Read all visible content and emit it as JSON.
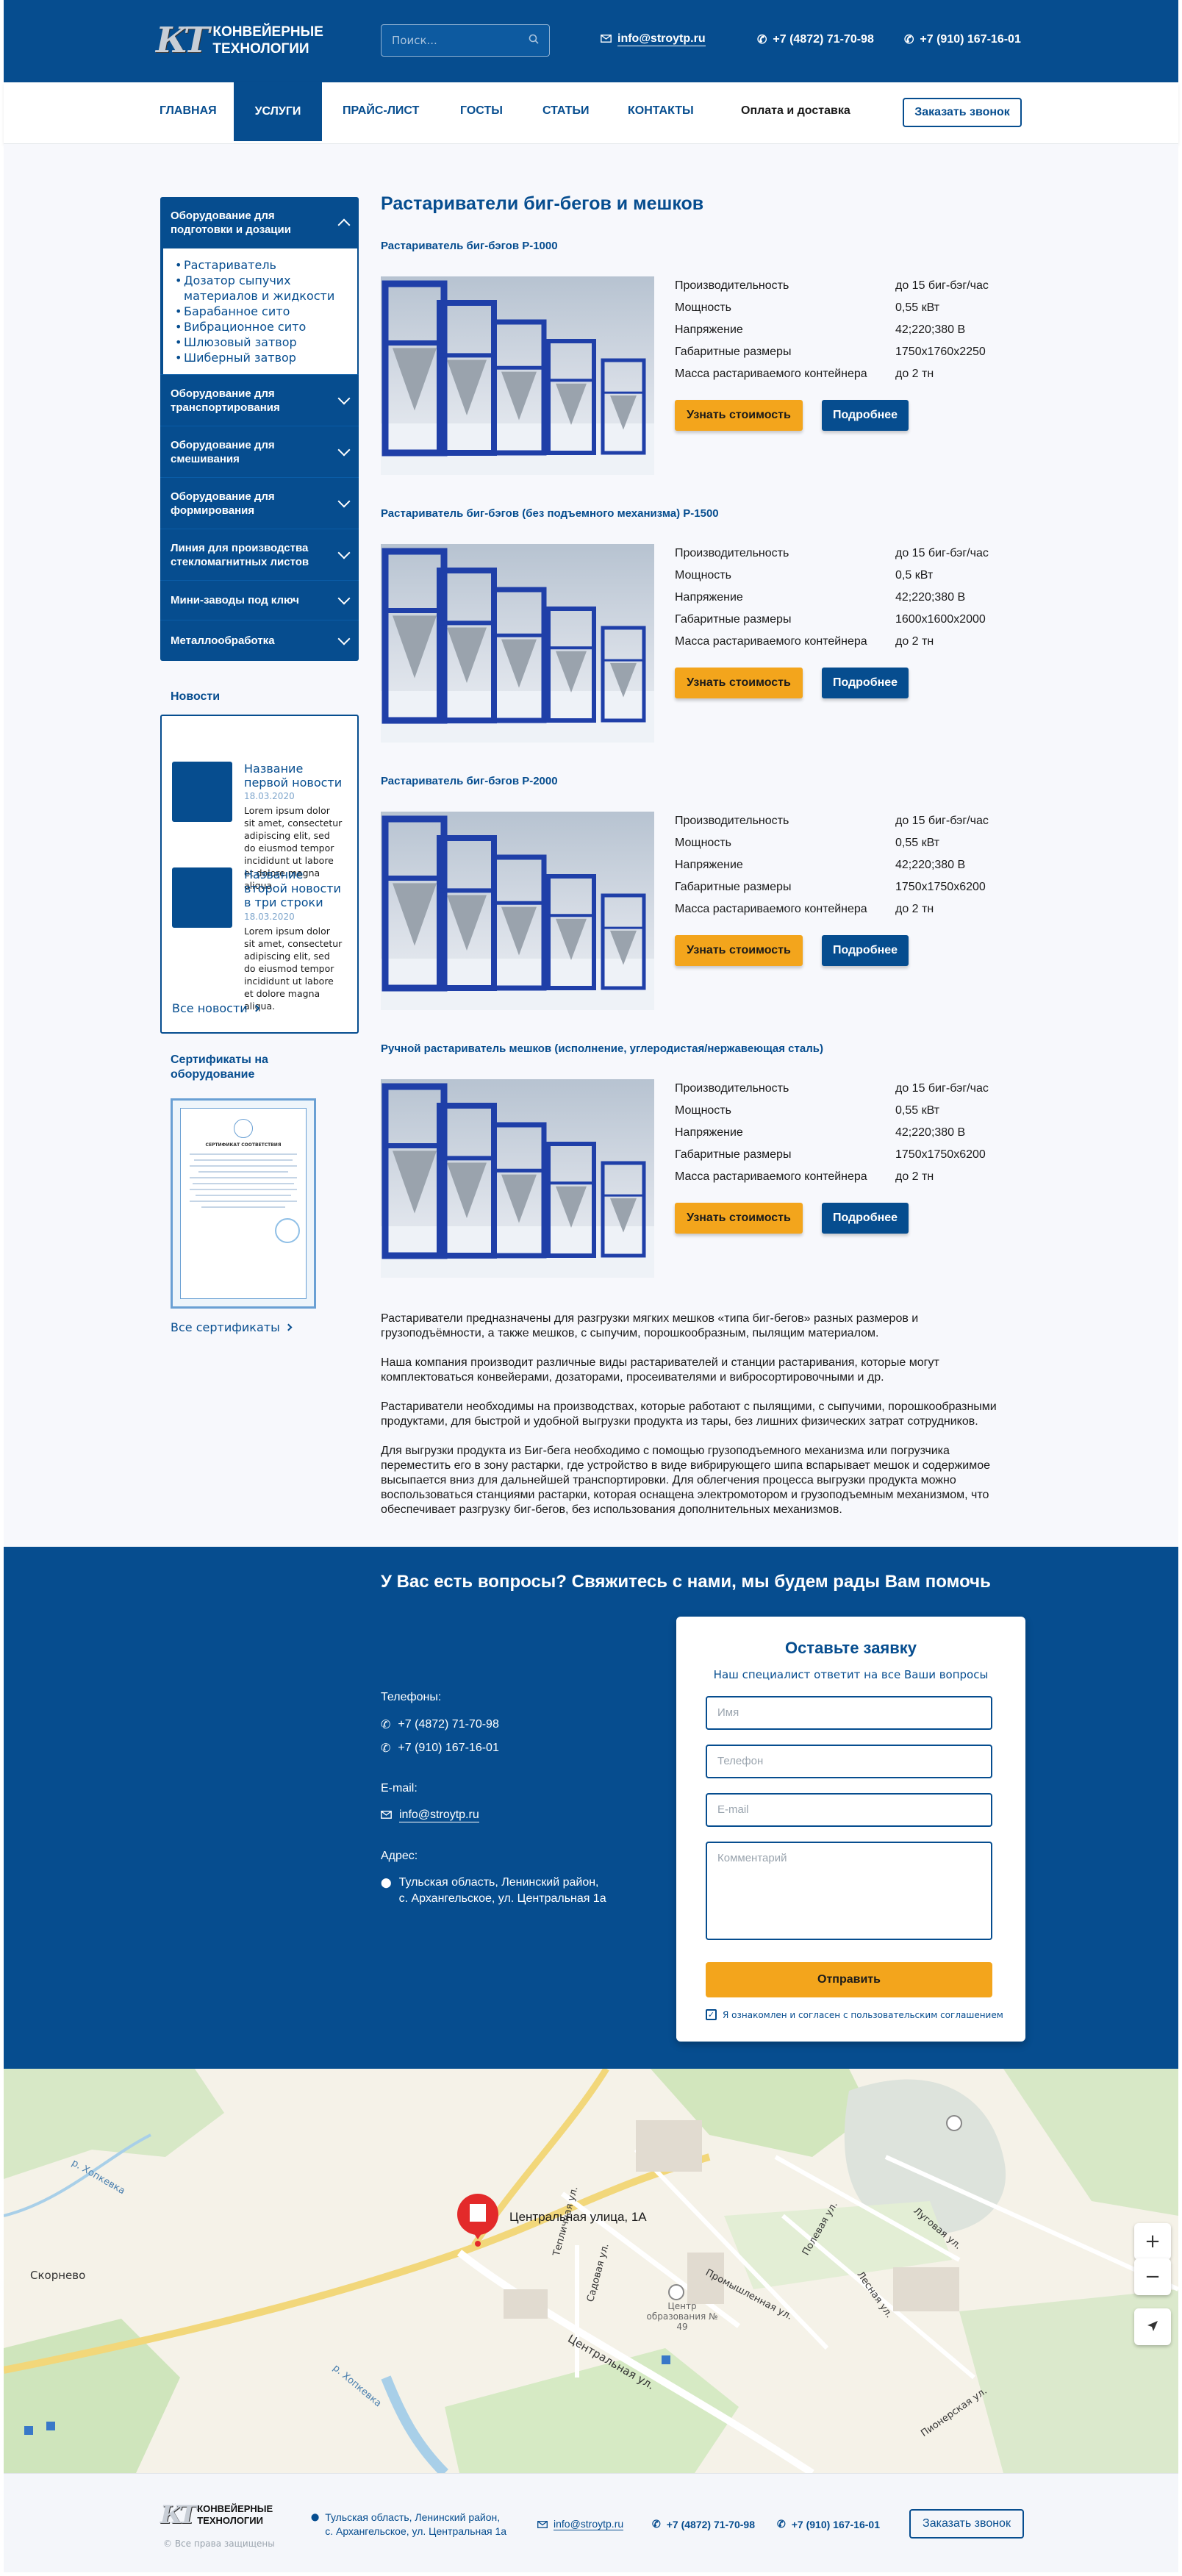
{
  "header": {
    "logo_letters": "КТ",
    "logo_line1": "КОНВЕЙЕРНЫЕ",
    "logo_line2": "ТЕХНОЛОГИИ",
    "search_placeholder": "Поиск...",
    "email": "info@stroytp.ru",
    "phone1": "+7 (4872) 71-70-98",
    "phone2": "+7 (910) 167-16-01"
  },
  "nav": {
    "items": [
      "ГЛАВНАЯ",
      "УСЛУГИ",
      "ПРАЙС-ЛИСТ",
      "ГОСТЫ",
      "СТАТЬИ",
      "КОНТАКТЫ",
      "Оплата и доставка"
    ],
    "active_index": 1,
    "call_button": "Заказать звонок"
  },
  "sidebar": {
    "open_category": "Оборудование для подготовки и дозации",
    "sub_items": [
      "Растариватель",
      "Дозатор сыпучих материалов и жидкости",
      "Барабанное сито",
      "Вибрационное сито",
      "Шлюзовый затвор",
      "Шиберный затвор"
    ],
    "categories": [
      "Оборудование для транспортирования",
      "Оборудование для смешивания",
      "Оборудование для формирования",
      "Линия для производства стекломагнитных листов",
      "Мини-заводы под ключ",
      "Металлообработка"
    ]
  },
  "news": {
    "title": "Новости",
    "items": [
      {
        "title": "Название первой новости",
        "date": "18.03.2020",
        "text": "Lorem ipsum dolor sit amet, consectetur adipiscing elit, sed do eiusmod tempor incididunt ut labore et dolore magna aliqua."
      },
      {
        "title": "Название второй новости в три строки",
        "date": "18.03.2020",
        "text": "Lorem ipsum dolor sit amet, consectetur adipiscing elit, sed do eiusmod tempor incididunt ut labore et dolore magna aliqua."
      }
    ],
    "all_link": "Все новости"
  },
  "certificates": {
    "title": "Сертификаты на оборудование",
    "all_link": "Все сертификаты",
    "doc_heading": "СЕРТИФИКАТ СООТВЕТСТВИЯ"
  },
  "main": {
    "title": "Растариватели биг-бегов и мешков",
    "spec_labels": [
      "Производительность",
      "Мощность",
      "Напряжение",
      "Габаритные размеры",
      "Масса растариваемого контейнера"
    ],
    "btn_price": "Узнать стоимость",
    "btn_more": "Подробнее",
    "products": [
      {
        "name": "Растариватель биг-бэгов Р-1000",
        "values": [
          "до 15 биг-бэг/час",
          "0,55 кВт",
          "42;220;380 В",
          "1750х1760х2250",
          "до 2 тн"
        ]
      },
      {
        "name": "Растариватель биг-бэгов (без подъемного механизма) Р-1500",
        "values": [
          "до 15 биг-бэг/час",
          "0,5 кВт",
          "42;220;380 В",
          "1600х1600х2000",
          "до 2 тн"
        ]
      },
      {
        "name": "Растариватель биг-бэгов Р-2000",
        "values": [
          "до 15 биг-бэг/час",
          "0,55 кВт",
          "42;220;380 В",
          "1750х1750х6200",
          "до 2 тн"
        ]
      },
      {
        "name": "Ручной растариватель мешков (исполнение, углеродистая/нержавеющая сталь)",
        "values": [
          "до 15 биг-бэг/час",
          "0,55 кВт",
          "42;220;380 В",
          "1750х1750х6200",
          "до 2 тн"
        ]
      }
    ],
    "description": [
      "Растариватели предназначены для разгрузки мягких мешков «типа биг-бегов» разных размеров и грузоподъёмности, а также мешков, с сыпучим, порошкообразным, пылящим материалом.",
      "Наша компания производит различные виды растаривателей и станции растаривания, которые могут комплектоваться конвейерами, дозаторами, просеивателями и вибросортировочными и др.",
      "Растариватели необходимы на производствах, которые работают с пылящими, с сыпучими, порошкообразными продуктами, для быстрой и удобной выгрузки продукта из тары, без лишних физических затрат сотрудников.",
      "Для выгрузки продукта из Биг-бега необходимо с помощью грузоподъемного механизма или погрузчика переместить его в зону растарки, где устройство в виде вибрирующего шипа вспарывает мешок и содержимое высыпается вниз для дальнейшей транспортировки. Для облегчения процесса выгрузки продукта можно воспользоваться станциями растарки, которая оснащена электромотором и грузоподъемным механизмом, что обеспечивает разгрузку биг-бегов, без использования дополнительных механизмов."
    ]
  },
  "contact": {
    "title": "У Вас есть вопросы? Свяжитесь с нами, мы будем рады Вам помочь",
    "phones_label": "Телефоны:",
    "phone1": "+7 (4872) 71-70-98",
    "phone2": "+7 (910) 167-16-01",
    "email_label": "E-mail:",
    "email": "info@stroytp.ru",
    "address_label": "Адрес:",
    "address_line1": "Тульская область, Ленинский район,",
    "address_line2": "с. Архангельское, ул. Центральная 1а",
    "form": {
      "title": "Оставьте заявку",
      "subtitle": "Наш специалист ответит на все Ваши вопросы",
      "name_placeholder": "Имя",
      "phone_placeholder": "Телефон",
      "email_placeholder": "E-mail",
      "comment_placeholder": "Комментарий",
      "submit": "Отправить",
      "agree": "Я ознакомлен и согласен с пользовательским соглашением"
    }
  },
  "map": {
    "marker_label": "Центральная улица, 1А",
    "labels": [
      "Скорнево",
      "р. Хопкевка",
      "Центральная ул.",
      "Садовая ул.",
      "Промышленная ул.",
      "Лесная ул.",
      "Полевая ул.",
      "Луговая ул.",
      "Пионерская ул.",
      "Центр образования № 49",
      "Тепличная ул.",
      "р. Хопкевка"
    ]
  },
  "footer": {
    "copyright": "© Все права защищены",
    "address_line1": "Тульская область, Ленинский район,",
    "address_line2": "с. Архангельское, ул. Центральная 1а",
    "email": "info@stroytp.ru",
    "phone1": "+7 (4872)  71-70-98",
    "phone2": "+7 (910) 167-16-01",
    "call_button": "Заказать звонок"
  },
  "colors": {
    "brand": "#064d8f",
    "accent": "#f3a51c",
    "background": "#f7f8fc"
  }
}
